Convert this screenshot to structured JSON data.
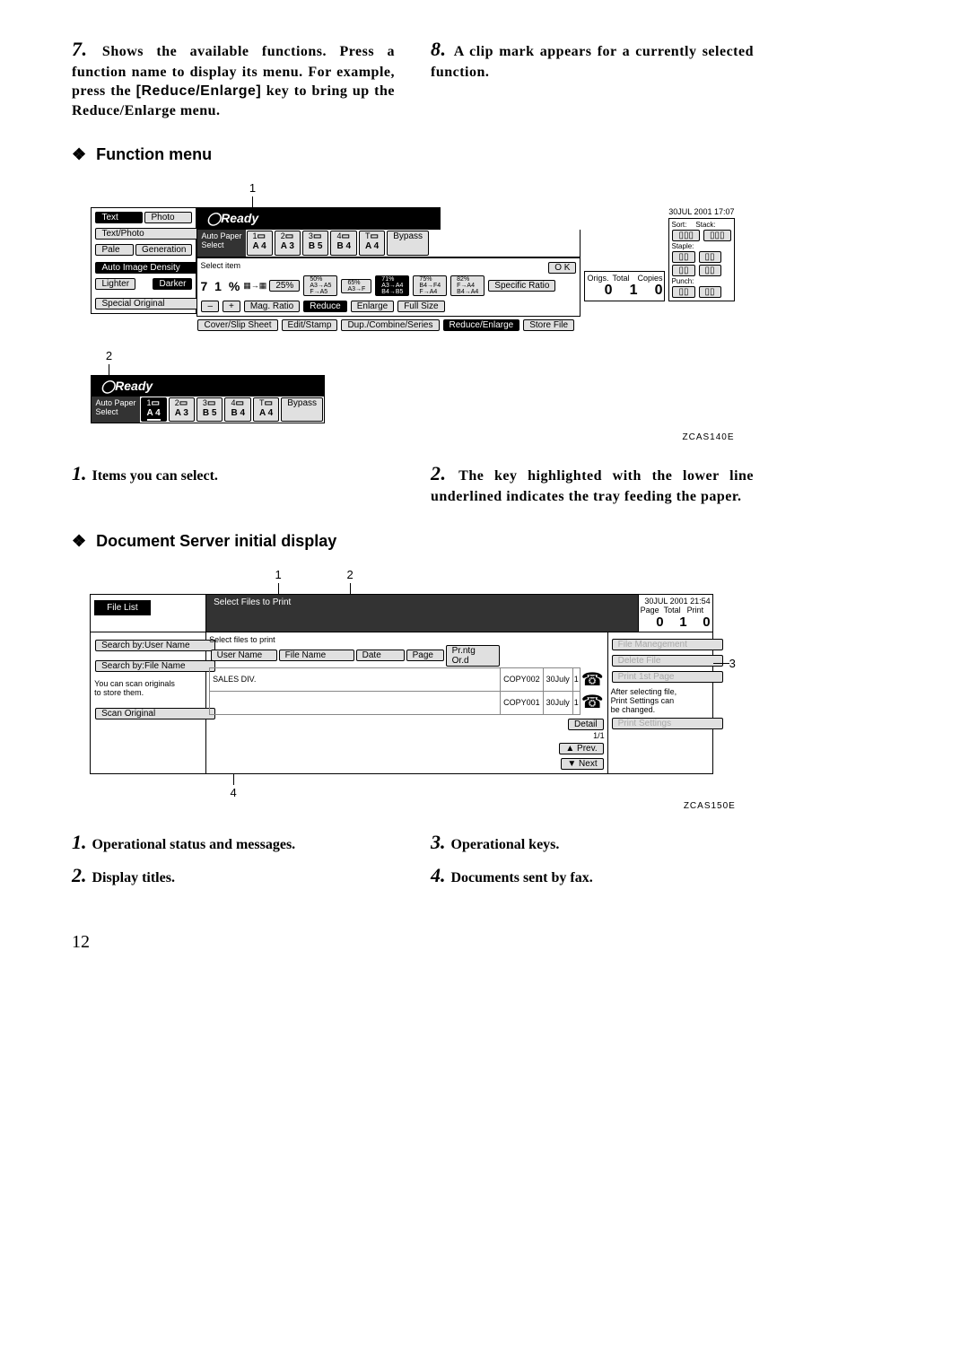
{
  "step7": {
    "num": "7.",
    "text_a": "Shows the available functions. Press a function name to display its menu. For example, press the ",
    "key": "[Re­duce/Enlarge]",
    "text_b": " key to bring up the Re­duce/Enlarge menu."
  },
  "step8": {
    "num": "8.",
    "text": "A clip mark appears for a current­ly selected function."
  },
  "h_func": "Function menu",
  "diamond": "❖",
  "fig1": {
    "callout1": "1",
    "callout2": "2",
    "ready": "Ready",
    "date": "30JUL  2001  17:07",
    "origs": "Origs.",
    "total": "Total",
    "copies": "Copies",
    "zero": "0",
    "one": "1",
    "tabs": {
      "text": "Text",
      "photo": "Photo",
      "tp": "Text/Photo",
      "pale": "Pale",
      "gen": "Generation"
    },
    "aid": "Auto Image Density",
    "lighter": "Lighter",
    "darker": "Darker",
    "special": "Special Original",
    "autopaper": "Auto Paper\nSelect",
    "trays": [
      "A 4",
      "A 3",
      "B 5",
      "B 4",
      "A 4"
    ],
    "trayidx": [
      "1",
      "2",
      "3",
      "4",
      "T"
    ],
    "bypass": "Bypass",
    "sort": "Sort:",
    "stack": "Stack:",
    "staple": "Staple:",
    "punch": "Punch:",
    "selectitem": "Select item",
    "pct": "7 1 %",
    "btns": {
      "25": "25%",
      "50": "50%\nA3→A5\nF→A5",
      "65": "65%\nA3→F",
      "71": "71%\nA3→A4\nB4→B5",
      "75": "75%\nB4→F4\nF→A4",
      "82": "82%\nF→A4\nB4→A4"
    },
    "spec": "Specific Ratio",
    "ok": "O K",
    "minus": "–",
    "plus": "+",
    "mag": "Mag. Ratio",
    "reduce": "Reduce",
    "enlarge": "Enlarge",
    "full": "Full Size",
    "cover": "Cover/Slip Sheet",
    "edit": "Edit/Stamp",
    "dup": "Dup./Combine/Series",
    "re": "Reduce/Enlarge",
    "store": "Store File",
    "code": "ZCAS140E"
  },
  "legend1": {
    "i1n": "1.",
    "i1t": "Items you can select.",
    "i2n": "2.",
    "i2t": "The key highlighted with the lower line underlined indicates the tray feeding the paper."
  },
  "h_doc": "Document Server initial display",
  "fig2": {
    "c1": "1",
    "c2": "2",
    "c3": "3",
    "c4": "4",
    "date": "30JUL  2001  21:54",
    "page": "Page",
    "total": "Total",
    "print": "Print",
    "zero": "0",
    "one": "1",
    "filelist": "File List",
    "sel": "Select Files to Print",
    "sbu": "Search by:User Name",
    "sbf": "Search by:File Name",
    "scan_note": "You can scan originals\nto store them.",
    "scan": "Scan Original",
    "sftp": "Select files to print",
    "un": "User Name",
    "fn": "File Name",
    "dt": "Date",
    "pg": "Page",
    "po": "Pr.ntg Or.d",
    "rows": [
      {
        "u": "SALES DIV.",
        "f": "COPY002",
        "d": "30July",
        "p": "1"
      },
      {
        "u": "",
        "f": "COPY001",
        "d": "30July",
        "p": "1"
      }
    ],
    "fhp": "File Manegement",
    "del": "Delete File",
    "pfp": "Print 1st Page",
    "after": "After selecting file,\nPrint Settings can\nbe changed.",
    "ps": "Print Settings",
    "detail": "Detail",
    "oneone": "1/1",
    "prev": "▲ Prev.",
    "next": "▼ Next",
    "code": "ZCAS150E"
  },
  "legend2": {
    "i1n": "1.",
    "i1t": "Operational status and messages.",
    "i2n": "2.",
    "i2t": "Display titles.",
    "i3n": "3.",
    "i3t": "Operational keys.",
    "i4n": "4.",
    "i4t": "Documents sent by fax."
  },
  "pagenum": "12"
}
